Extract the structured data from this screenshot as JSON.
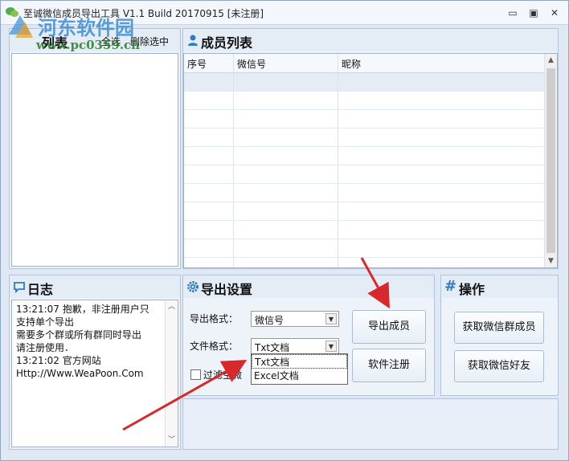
{
  "titlebar": {
    "title": "至诚微信成员导出工具 V1.1 Build 20170915   [未注册]",
    "minimize": "▭",
    "restore": "▣",
    "close": "✕"
  },
  "watermark": {
    "title": "河东软件园",
    "url": "www.pc0359.cn"
  },
  "group_panel": {
    "title": "列表",
    "select_all": "全选",
    "delete_selected": "删除选中"
  },
  "member_panel": {
    "title": "成员列表",
    "icon": "user-icon",
    "columns": [
      "序号",
      "微信号",
      "昵称"
    ]
  },
  "log_panel": {
    "title": "日志",
    "icon": "chat-bubble-icon",
    "lines": [
      "13:21:07    抱歉，非注册用户只",
      "支持单个导出",
      "需要多个群或所有群同时导出",
      "请注册使用．",
      "13:21:02    官方网站",
      "Http://Www.WeaPoon.Com"
    ]
  },
  "export_panel": {
    "title": "导出设置",
    "icon": "gear-icon",
    "export_format_label": "导出格式：",
    "export_format_value": "微信号",
    "file_format_label": "文件格式：",
    "file_format_value": "Txt文档",
    "file_format_options": [
      "Txt文档",
      "Excel文档"
    ],
    "filter_label": "过滤空微",
    "export_button": "导出成员",
    "register_button": "软件注册"
  },
  "ops_panel": {
    "title": "操作",
    "icon": "hash-icon",
    "get_group_members": "获取微信群成员",
    "get_friends": "获取微信好友"
  },
  "colors": {
    "accent": "#2e7cc6",
    "annotation_arrow": "#d9282b"
  }
}
